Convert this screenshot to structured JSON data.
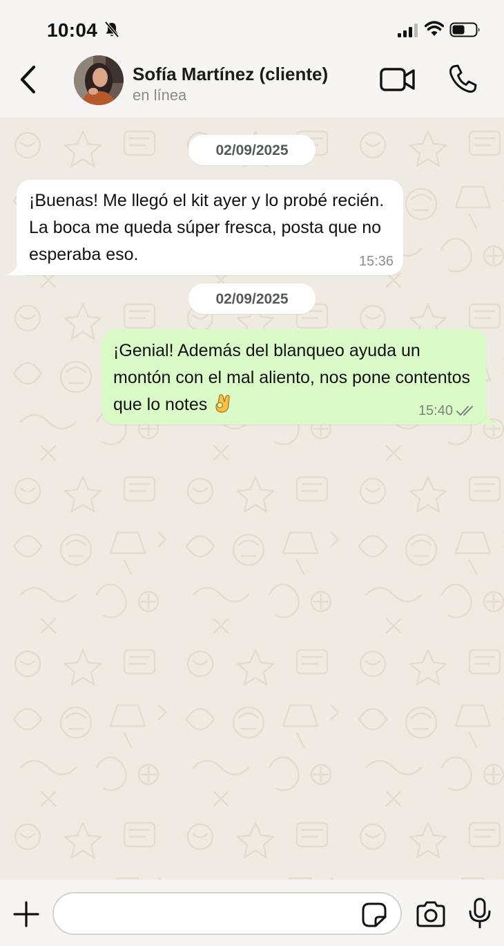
{
  "status_bar": {
    "time": "10:04",
    "icons": [
      "bell-slash-icon",
      "cellular-signal-icon",
      "wifi-icon",
      "battery-icon"
    ]
  },
  "header": {
    "back_icon": "chevron-left-icon",
    "contact_name": "Sofía Martínez (cliente)",
    "contact_status": "en línea",
    "actions": [
      "video-call-icon",
      "phone-icon"
    ]
  },
  "chat": {
    "messages": [
      {
        "date_separator": "02/09/2025",
        "direction": "incoming",
        "text": "¡Buenas! Me llegó el kit ayer y lo probé recién. La boca me queda súper fresca, posta que no esperaba eso.",
        "time": "15:36"
      },
      {
        "date_separator": "02/09/2025",
        "direction": "outgoing",
        "text": "¡Genial! Además del blanqueo ayuda un montón con el mal aliento, nos pone contentos que lo notes",
        "emoji": "ok-hand-emoji",
        "time": "15:40",
        "status": "read"
      }
    ]
  },
  "composer": {
    "value": "",
    "icons": [
      "plus-icon",
      "sticker-icon",
      "camera-icon",
      "microphone-icon"
    ]
  },
  "colors": {
    "header_bg": "#f6f5f3",
    "chat_bg": "#efeae2",
    "incoming_bubble": "#ffffff",
    "outgoing_bubble": "#dafbc8"
  }
}
